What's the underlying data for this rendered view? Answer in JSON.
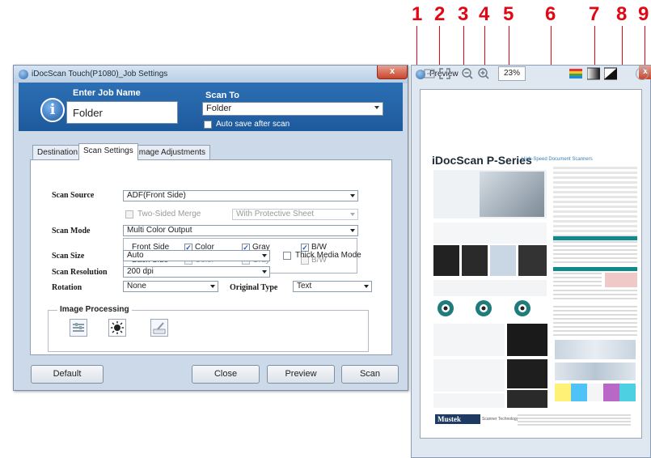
{
  "callouts": [
    "1",
    "2",
    "3",
    "4",
    "5",
    "6",
    "7",
    "8",
    "9"
  ],
  "job_window": {
    "title": "iDocScan Touch(P1080)_Job Settings",
    "close_glyph": "x",
    "job_name_label": "Enter Job Name",
    "job_name_value": "Folder",
    "scan_to_label": "Scan To",
    "scan_to_value": "Folder",
    "auto_save_label": "Auto save after scan",
    "tabs": [
      "Destination",
      "Scan Settings",
      "Image Adjustments"
    ],
    "scan_source": {
      "label": "Scan Source",
      "value": "ADF(Front Side)"
    },
    "two_sided_merge": {
      "label": "Two-Sided Merge",
      "value": "With Protective Sheet"
    },
    "scan_mode": {
      "label": "Scan Mode",
      "value": "Multi Color Output"
    },
    "front_side": {
      "label": "Front Side",
      "options": [
        "Color",
        "Gray",
        "B/W"
      ]
    },
    "back_side": {
      "label": "Back Side",
      "options": [
        "Color",
        "Gray",
        "B/W"
      ]
    },
    "scan_size": {
      "label": "Scan Size",
      "value": "Auto"
    },
    "thick_media_label": "Thick Media Mode",
    "scan_resolution": {
      "label": "Scan Resolution",
      "value": "200 dpi"
    },
    "rotation": {
      "label": "Rotation",
      "value": "None"
    },
    "original_type": {
      "label": "Original Type",
      "value": "Text"
    },
    "image_processing_label": "Image Processing",
    "buttons": {
      "default": "Default",
      "close": "Close",
      "preview": "Preview",
      "scan": "Scan"
    }
  },
  "preview_window": {
    "title": "Preview",
    "close_glyph": "x",
    "zoom": "23%",
    "help_glyph": "?",
    "doc_title": "iDocScan P-Series",
    "doc_subtitle": "High-Speed Document Scanners",
    "doc_logo": "Mustek",
    "doc_logo_tag": "Scanner Technology"
  },
  "colors": {
    "accent": "#e30613",
    "header_blue": "#2d6fb4"
  }
}
